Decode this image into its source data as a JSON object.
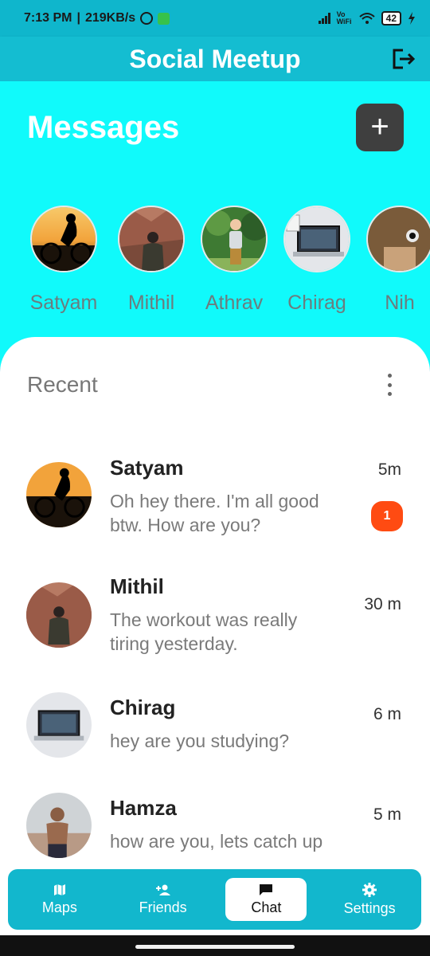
{
  "statusbar": {
    "time": "7:13 PM",
    "net_speed": "219KB/s",
    "wifi_label": "Vo WiFi",
    "battery": "42"
  },
  "app": {
    "title": "Social Meetup"
  },
  "header": {
    "title": "Messages",
    "add_label": "+"
  },
  "stories": [
    {
      "name": "Satyam",
      "photo": "avatar-sunset-cyclist"
    },
    {
      "name": "Mithil",
      "photo": "avatar-hiker-canyon"
    },
    {
      "name": "Athrav",
      "photo": "avatar-child-garden"
    },
    {
      "name": "Chirag",
      "photo": "avatar-laptop-desk"
    },
    {
      "name": "Nih",
      "photo": "avatar-partial"
    }
  ],
  "recent": {
    "title": "Recent",
    "chats": [
      {
        "name": "Satyam",
        "message": "Oh hey there. I'm all good btw. How are you?",
        "time": "5m",
        "unread": "1"
      },
      {
        "name": "Mithil",
        "message": "The workout was really tiring yesterday.",
        "time": "30 m"
      },
      {
        "name": "Chirag",
        "message": "hey are you studying?",
        "time": "6 m"
      },
      {
        "name": "Hamza",
        "message": "how are you, lets catch up",
        "time": "5 m"
      }
    ]
  },
  "nav": {
    "items": [
      {
        "label": "Maps",
        "icon": "map-icon"
      },
      {
        "label": "Friends",
        "icon": "add-person-icon"
      },
      {
        "label": "Chat",
        "icon": "chat-icon",
        "active": true
      },
      {
        "label": "Settings",
        "icon": "gear-icon"
      }
    ]
  },
  "colors": {
    "accent": "#13b9cf",
    "hero": "#10fafb",
    "badge": "#ff4b12",
    "add_button": "#3f3f3f"
  }
}
